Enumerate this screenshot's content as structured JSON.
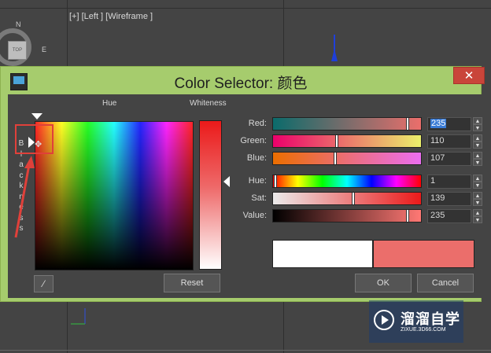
{
  "viewport": {
    "label": "[+] [Left ] [Wireframe ]",
    "compass_n": "N",
    "compass_e": "E",
    "cube_label": "TOP"
  },
  "dialog": {
    "title": "Color Selector: 颜色",
    "close_label": "✕",
    "hue_label": "Hue",
    "whiteness_label": "Whiteness",
    "blackness_letters": [
      "B",
      "l",
      "a",
      "c",
      "k",
      "n",
      "e",
      "s",
      "s"
    ],
    "reset_label": "Reset",
    "ok_label": "OK",
    "cancel_label": "Cancel",
    "rows": {
      "red": {
        "label": "Red:",
        "value": "235"
      },
      "green": {
        "label": "Green:",
        "value": "110"
      },
      "blue": {
        "label": "Blue:",
        "value": "107"
      },
      "hue": {
        "label": "Hue:",
        "value": "1"
      },
      "sat": {
        "label": "Sat:",
        "value": "139"
      },
      "value": {
        "label": "Value:",
        "value": "235"
      }
    },
    "slider_levels": {
      "red": 0.92,
      "green": 0.43,
      "blue": 0.42,
      "hue": 0.004,
      "sat": 0.545,
      "value": 0.92
    },
    "colors": {
      "old_color": "#ffffff",
      "new_color": "#eb6e6b",
      "title_bar": "#a6cc6d",
      "close": "#c9453a"
    }
  },
  "watermark": {
    "title": "溜溜自学",
    "url": "ZIXUE.3D66.COM"
  }
}
